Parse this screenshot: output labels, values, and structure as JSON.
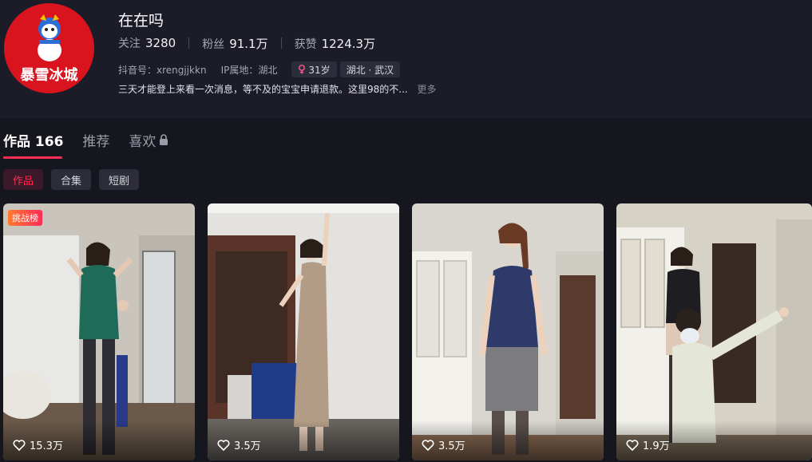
{
  "profile": {
    "avatar_text": "暴雪冰城",
    "name": "在在吗",
    "stats": [
      {
        "label": "关注",
        "value": "3280"
      },
      {
        "label": "粉丝",
        "value": "91.1万"
      },
      {
        "label": "获赞",
        "value": "1224.3万"
      }
    ],
    "douyin_id": "抖音号：xrengjjkkn",
    "ip_location": "IP属地：湖北",
    "age_tag": "31岁",
    "region_tag": "湖北 · 武汉",
    "bio": "三天才能登上来看一次消息，等不及的宝宝申请退款。这里98的不...",
    "bio_more": "更多"
  },
  "tabs": [
    {
      "label": "作品 166"
    },
    {
      "label": "推荐"
    },
    {
      "label": "喜欢"
    }
  ],
  "filters": [
    "作品",
    "合集",
    "短剧"
  ],
  "videos": [
    {
      "likes": "15.3万",
      "badge": "挑战榜"
    },
    {
      "likes": "3.5万"
    },
    {
      "likes": "3.5万"
    },
    {
      "likes": "1.9万"
    }
  ],
  "colors": {
    "accent": "#fe2c55",
    "avatar_bg": "#d9141e",
    "background": "#16161f"
  },
  "icons": [
    "lock-icon",
    "heart-icon",
    "female-icon"
  ]
}
